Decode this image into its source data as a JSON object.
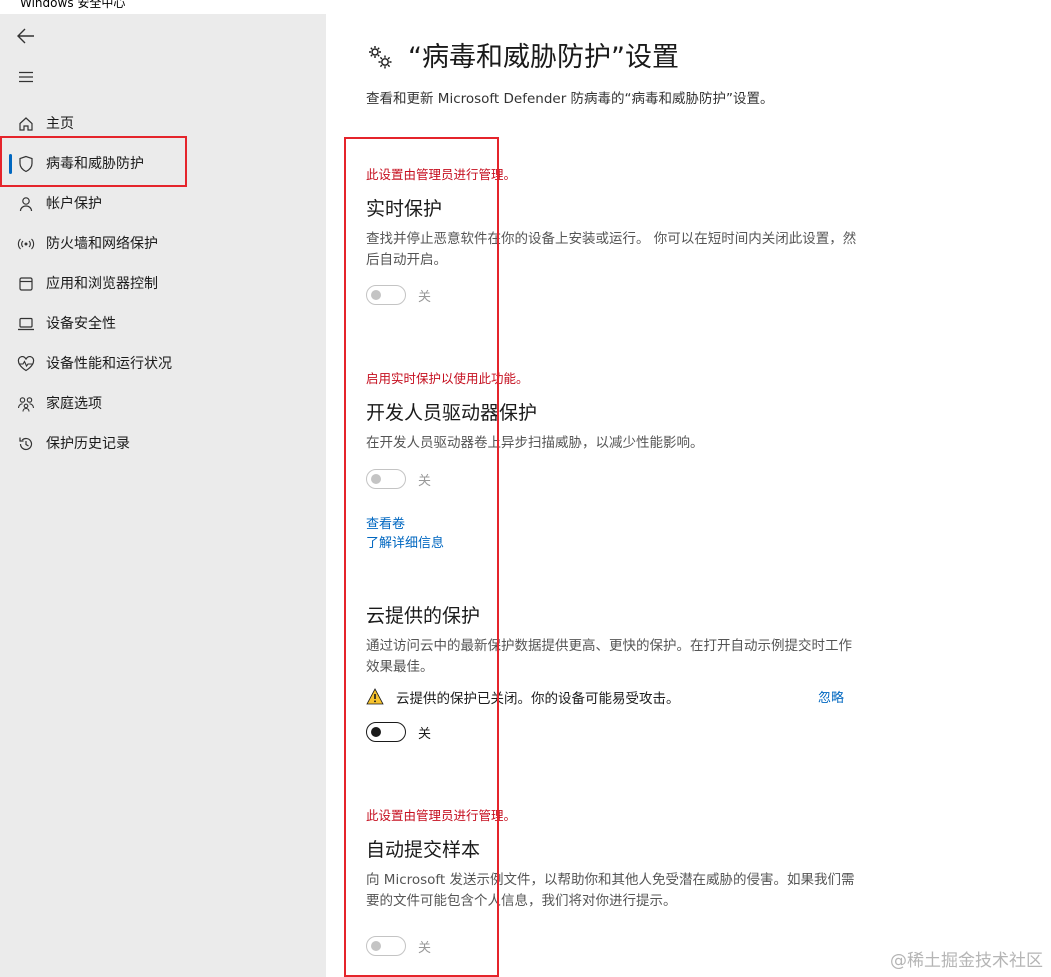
{
  "window": {
    "title": "Windows 安全中心"
  },
  "sidebar": {
    "back_icon": "back-arrow-icon",
    "menu_icon": "hamburger-icon",
    "items": [
      {
        "label": "主页",
        "icon": "home-icon",
        "active": false
      },
      {
        "label": "病毒和威胁防护",
        "icon": "shield-icon",
        "active": true
      },
      {
        "label": "帐户保护",
        "icon": "person-icon",
        "active": false
      },
      {
        "label": "防火墙和网络保护",
        "icon": "wifi-antenna-icon",
        "active": false
      },
      {
        "label": "应用和浏览器控制",
        "icon": "app-window-icon",
        "active": false
      },
      {
        "label": "设备安全性",
        "icon": "laptop-icon",
        "active": false
      },
      {
        "label": "设备性能和运行状况",
        "icon": "heart-pulse-icon",
        "active": false
      },
      {
        "label": "家庭选项",
        "icon": "family-icon",
        "active": false
      },
      {
        "label": "保护历史记录",
        "icon": "history-icon",
        "active": false
      }
    ]
  },
  "main": {
    "title": "“病毒和威胁防护”设置",
    "subtitle": "查看和更新 Microsoft Defender 防病毒的“病毒和威胁防护”设置。",
    "realtime": {
      "managed_note": "此设置由管理员进行管理。",
      "title": "实时保护",
      "description": "查找并停止恶意软件在你的设备上安装或运行。 你可以在短时间内关闭此设置，然后自动开启。",
      "toggle_label": "关",
      "enabled": false
    },
    "dev_drive": {
      "note": "启用实时保护以使用此功能。",
      "title": "开发人员驱动器保护",
      "description": "在开发人员驱动器卷上异步扫描威胁，以减少性能影响。",
      "toggle_label": "关",
      "enabled": false,
      "link_view_volumes": "查看卷",
      "link_learn_more": "了解详细信息"
    },
    "cloud": {
      "title": "云提供的保护",
      "description": "通过访问云中的最新保护数据提供更高、更快的保护。在打开自动示例提交时工作效果最佳。",
      "warning": "云提供的保护已关闭。你的设备可能易受攻击。",
      "dismiss": "忽略",
      "toggle_label": "关",
      "enabled": true
    },
    "sample": {
      "managed_note": "此设置由管理员进行管理。",
      "title": "自动提交样本",
      "description": "向 Microsoft 发送示例文件，以帮助你和其他人免受潜在威胁的侵害。如果我们需要的文件可能包含个人信息，我们将对你进行提示。",
      "toggle_label": "关",
      "enabled": false
    }
  },
  "watermark": "@稀土掘金技术社区",
  "colors": {
    "sidebar_bg": "#ebebeb",
    "accent": "#0067c0",
    "managed_red": "#c50f1f",
    "annotation_red": "#e5242b",
    "warning_yellow": "#f7c32e"
  }
}
